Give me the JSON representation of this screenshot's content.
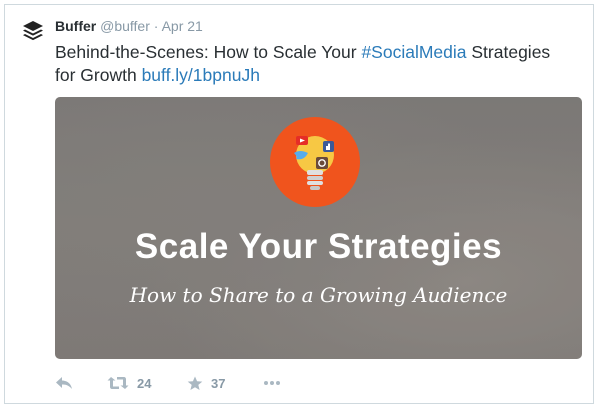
{
  "tweet": {
    "name": "Buffer",
    "handle": "@buffer",
    "separator": "·",
    "date": "Apr 21",
    "text_before": "Behind-the-Scenes: How to Scale Your ",
    "hashtag": "#SocialMedia",
    "text_after": " Strategies for Growth ",
    "link": "buff.ly/1bpnuJh"
  },
  "card": {
    "title": "Scale Your Strategies",
    "subtitle": "How to Share to a Growing Audience",
    "accent_color": "#f0541d"
  },
  "actions": {
    "reply_icon": "reply-icon",
    "retweet_icon": "retweet-icon",
    "retweet_count": "24",
    "favorite_icon": "star-icon",
    "favorite_count": "37",
    "more_icon": "more-icon"
  },
  "colors": {
    "link": "#2b7bb9",
    "muted": "#8899a6",
    "text": "#292f33"
  }
}
